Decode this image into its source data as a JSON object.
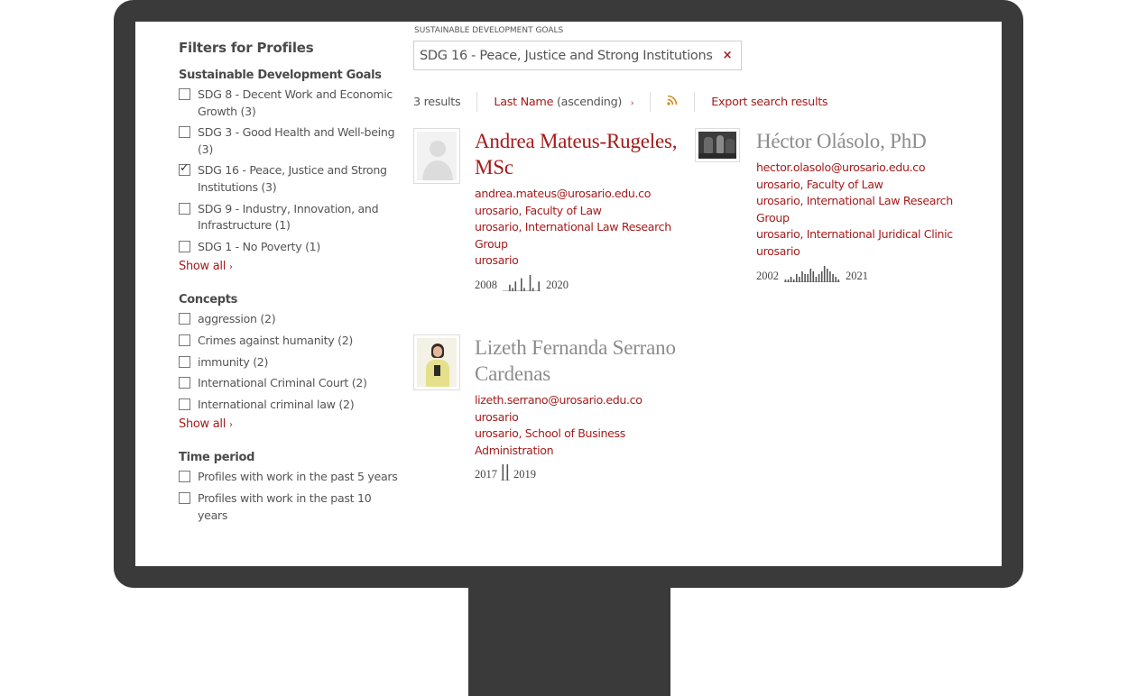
{
  "sidebar": {
    "title": "Filters for Profiles",
    "sdg_group": {
      "title": "Sustainable Development Goals",
      "items": [
        {
          "label": "SDG 8 - Decent Work and Economic Growth (3)",
          "checked": false
        },
        {
          "label": "SDG 3 - Good Health and Well-being (3)",
          "checked": false
        },
        {
          "label": "SDG 16 - Peace, Justice and Strong Institutions (3)",
          "checked": true
        },
        {
          "label": "SDG 9 - Industry, Innovation, and Infrastructure (1)",
          "checked": false
        },
        {
          "label": "SDG 1 - No Poverty (1)",
          "checked": false
        }
      ],
      "show_all": "Show all"
    },
    "concepts_group": {
      "title": "Concepts",
      "items": [
        {
          "label": "aggression (2)",
          "checked": false
        },
        {
          "label": "Crimes against humanity (2)",
          "checked": false
        },
        {
          "label": "immunity (2)",
          "checked": false
        },
        {
          "label": "International Criminal Court (2)",
          "checked": false
        },
        {
          "label": "International criminal law (2)",
          "checked": false
        }
      ],
      "show_all": "Show all"
    },
    "time_group": {
      "title": "Time period",
      "items": [
        {
          "label": "Profiles with work in the past 5 years",
          "checked": false
        },
        {
          "label": "Profiles with work in the past 10 years",
          "checked": false
        }
      ]
    }
  },
  "active_filter": {
    "group_label": "SUSTAINABLE DEVELOPMENT GOALS",
    "chip_label": "SDG 16 - Peace, Justice and Strong Institutions",
    "remove_icon": "×"
  },
  "results_bar": {
    "count": "3 results",
    "sort_field": "Last Name",
    "sort_direction": "(ascending)",
    "rss_icon": "rss-icon",
    "export_label": "Export search results"
  },
  "profiles": [
    {
      "name": "Andrea Mateus-Rugeles, MSc",
      "email": "andrea.mateus@urosario.edu.co",
      "affiliations": [
        "urosario, Faculty of Law",
        "urosario, International Law Research Group",
        "urosario"
      ],
      "start_year": "2008",
      "end_year": "2020",
      "activity": [
        0,
        0,
        2,
        1,
        3,
        0,
        4,
        1,
        0,
        5,
        1,
        0,
        3
      ]
    },
    {
      "name": "Héctor Olásolo, PhD",
      "email": "hector.olasolo@urosario.edu.co",
      "affiliations": [
        "urosario, Faculty of Law",
        "urosario, International Law Research Group",
        "urosario, International Juridical Clinic",
        "urosario"
      ],
      "start_year": "2002",
      "end_year": "2021",
      "activity": [
        1,
        1,
        2,
        1,
        3,
        2,
        4,
        3,
        3,
        5,
        4,
        2,
        3,
        4,
        6,
        5,
        4,
        3,
        2,
        1
      ]
    },
    {
      "name": "Lizeth Fernanda Serrano Cardenas",
      "email": "lizeth.serrano@urosario.edu.co",
      "affiliations": [
        "urosario",
        "urosario, School of Business Administration"
      ],
      "start_year": "2017",
      "end_year": "2019",
      "activity": [
        5,
        5
      ]
    }
  ],
  "colors": {
    "accent": "#a51c1c",
    "frame": "#3a3a3a",
    "name_grey": "#8c8c8c",
    "rss": "#d08a1c"
  }
}
